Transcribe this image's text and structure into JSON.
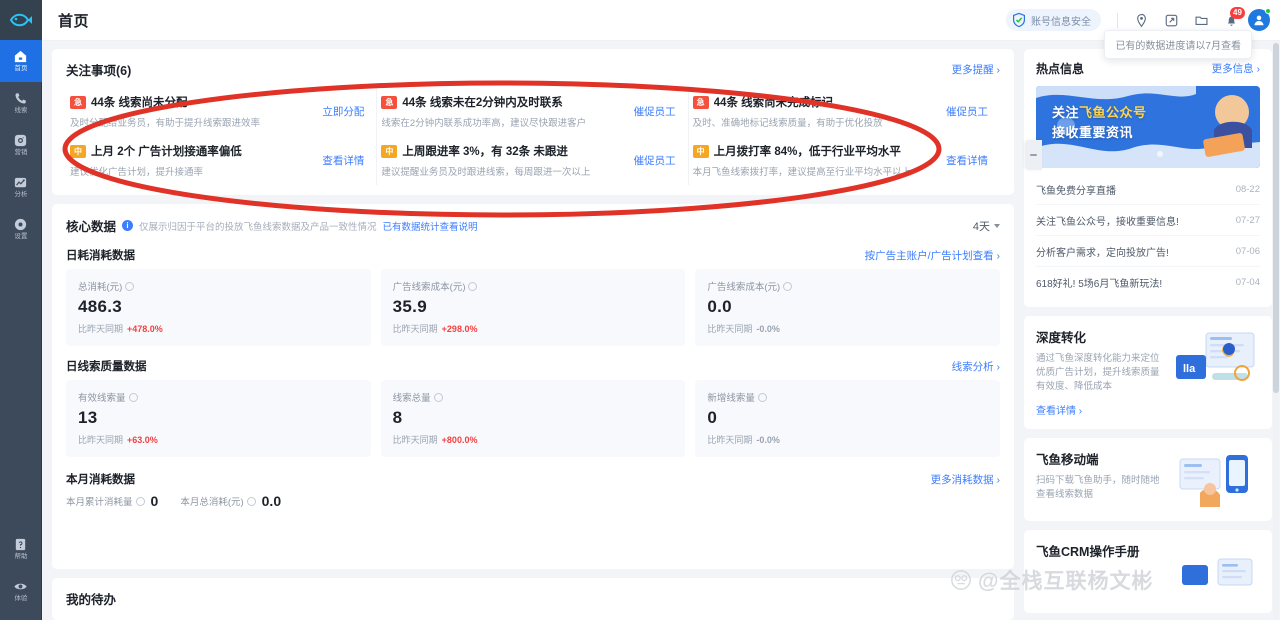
{
  "sidebar": {
    "logo_name": "feiyu-fish-logo",
    "items": [
      {
        "label": "首页",
        "icon": "home-icon",
        "active": true
      },
      {
        "label": "线索",
        "icon": "phone-icon",
        "active": false
      },
      {
        "label": "营销",
        "icon": "megaphone-icon",
        "active": false
      },
      {
        "label": "分析",
        "icon": "chart-icon",
        "active": false
      },
      {
        "label": "设置",
        "icon": "gear-icon",
        "active": false
      }
    ],
    "bottom_items": [
      {
        "label": "帮助",
        "icon": "help-doc-icon"
      },
      {
        "label": "体验",
        "icon": "eye-icon"
      }
    ]
  },
  "topbar": {
    "title": "首页",
    "secure_label": "账号信息安全",
    "tooltip": "已有的数据进度请以7月查看",
    "icons": [
      {
        "name": "location-icon"
      },
      {
        "name": "external-link-icon"
      },
      {
        "name": "folder-icon"
      },
      {
        "name": "bell-icon",
        "badge": "49"
      }
    ],
    "avatar_name": "user-avatar"
  },
  "focus": {
    "title": "关注事项(6)",
    "more_label": "更多提醒 ›",
    "items": [
      {
        "tag": "急",
        "tag_color": "red",
        "title": "44条 线索尚未分配",
        "desc": "及时分配给业务员，有助于提升线索跟进效率",
        "action": "立即分配"
      },
      {
        "tag": "急",
        "tag_color": "red",
        "title": "44条 线索未在2分钟内及时联系",
        "desc": "线索在2分钟内联系成功率高，建议尽快跟进客户",
        "action": "催促员工"
      },
      {
        "tag": "急",
        "tag_color": "red",
        "title": "44条 线索尚未完成标记",
        "desc": "及时、准确地标记线索质量，有助于优化投放",
        "action": "催促员工"
      },
      {
        "tag": "中",
        "tag_color": "orange",
        "title": "上月 2个 广告计划接通率偏低",
        "desc": "建议优化广告计划，提升接通率",
        "action": "查看详情"
      },
      {
        "tag": "中",
        "tag_color": "orange",
        "title": "上周跟进率 3%，有 32条 未跟进",
        "desc": "建议提醒业务员及时跟进线索，每周跟进一次以上",
        "action": "催促员工"
      },
      {
        "tag": "中",
        "tag_color": "orange",
        "title": "上月拨打率 84%，低于行业平均水平",
        "desc": "本月飞鱼线索拨打率，建议提高至行业平均水平以上",
        "action": "查看详情"
      }
    ]
  },
  "core": {
    "title": "核心数据",
    "note": "仅展示归因于平台的投放飞鱼线索数据及产品一致性情况",
    "note_link": "已有数据统计查看说明",
    "range": "4天",
    "sections": [
      {
        "sub_title": "日耗消耗数据",
        "link": "按广告主账户/广告计划查看 ›",
        "metrics": [
          {
            "label": "总消耗(元)",
            "value": "486.3",
            "compare_label": "比昨天同期",
            "delta": "+478.0%",
            "delta_dir": "up"
          },
          {
            "label": "广告线索成本(元)",
            "value": "35.9",
            "compare_label": "比昨天同期",
            "delta": "+298.0%",
            "delta_dir": "up"
          },
          {
            "label": "广告线索成本(元)",
            "value": "0.0",
            "compare_label": "比昨天同期",
            "delta": "-0.0%",
            "delta_dir": "flat"
          }
        ]
      },
      {
        "sub_title": "日线索质量数据",
        "link": "线索分析 ›",
        "metrics": [
          {
            "label": "有效线索量",
            "value": "13",
            "compare_label": "比昨天同期",
            "delta": "+63.0%",
            "delta_dir": "up"
          },
          {
            "label": "线索总量",
            "value": "8",
            "compare_label": "比昨天同期",
            "delta": "+800.0%",
            "delta_dir": "up"
          },
          {
            "label": "新增线索量",
            "value": "0",
            "compare_label": "比昨天同期",
            "delta": "-0.0%",
            "delta_dir": "flat"
          }
        ]
      }
    ],
    "month": {
      "sub_title": "本月消耗数据",
      "link": "更多消耗数据 ›",
      "values": [
        {
          "label": "本月累计消耗量",
          "value": "0"
        },
        {
          "label": "本月总消耗(元)",
          "value": "0.0"
        }
      ]
    }
  },
  "todo": {
    "title": "我的待办"
  },
  "side": {
    "hot": {
      "title": "热点信息",
      "more_label": "更多信息 ›",
      "banner_line1_a": "关注",
      "banner_line1_b": "飞鱼公众号",
      "banner_line2": "接收重要资讯",
      "news": [
        {
          "title": "飞鱼免费分享直播",
          "date": "08-22"
        },
        {
          "title": "关注飞鱼公众号，接收重要信息!",
          "date": "07-27"
        },
        {
          "title": "分析客户需求，定向投放广告!",
          "date": "07-06"
        },
        {
          "title": "618好礼! 5场6月飞鱼新玩法!",
          "date": "07-04"
        }
      ]
    },
    "promos": [
      {
        "title": "深度转化",
        "desc": "通过飞鱼深度转化能力来定位优质广告计划，提升线索质量有效度、降低成本",
        "link": "查看详情 ›",
        "art": "analytics-illustration"
      },
      {
        "title": "飞鱼移动端",
        "desc": "扫码下载飞鱼助手，随时随地查看线索数据",
        "link": "",
        "art": "mobile-illustration"
      },
      {
        "title": "飞鱼CRM操作手册",
        "desc": "",
        "link": "",
        "art": "doc-illustration"
      }
    ]
  },
  "annotation": {
    "shape": "red-ellipse-highlight"
  },
  "watermark": {
    "text": "@全栈互联杨文彬"
  },
  "colors": {
    "accent": "#3c7eff",
    "sidebar_bg": "#3d4a5c",
    "active_blue": "#1f6fe5",
    "danger": "#f53f3f",
    "warning": "#f5a623",
    "annotation_red": "#e03226"
  }
}
